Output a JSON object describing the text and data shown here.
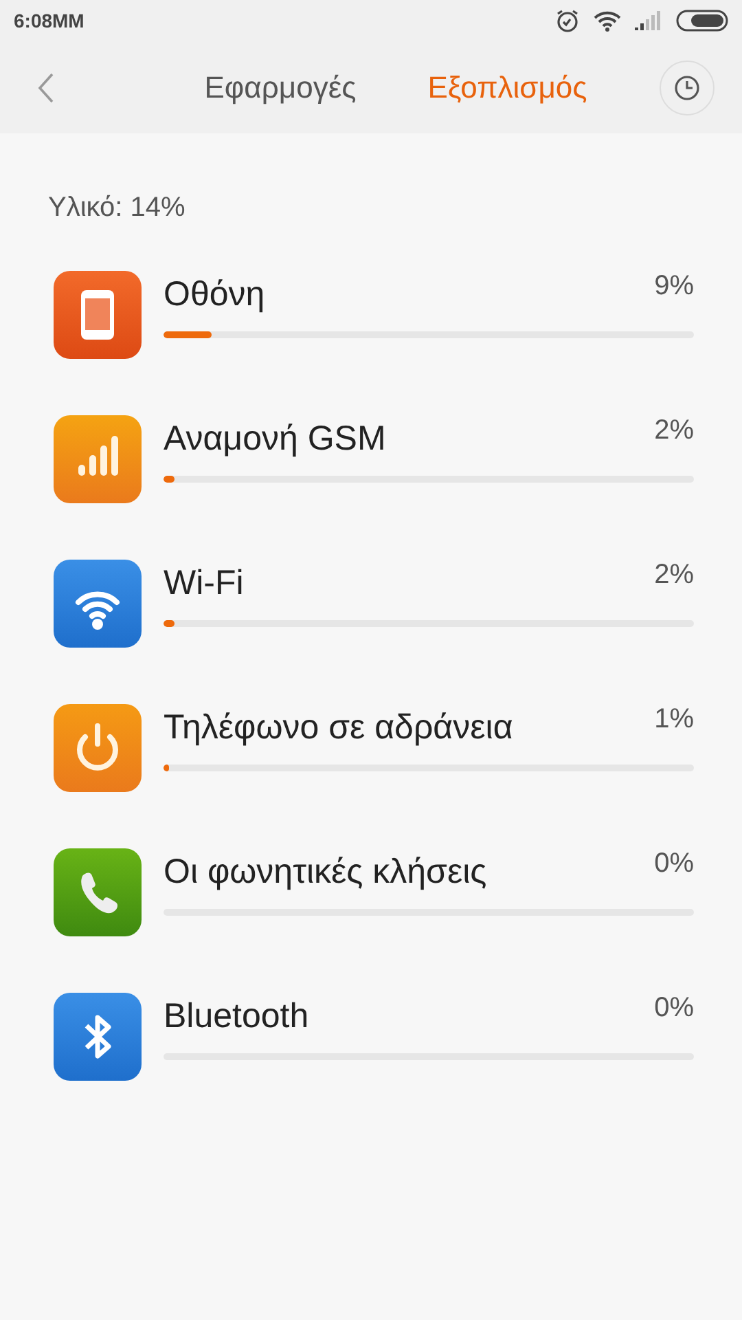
{
  "status_bar": {
    "time": "6:08MM"
  },
  "tabs": [
    {
      "label": "Εφαρμογές",
      "selected": false
    },
    {
      "label": "Εξοπλισμός",
      "selected": true
    }
  ],
  "summary": "Υλικό: 14%",
  "items": [
    {
      "kind": "screen",
      "name": "Οθόνη",
      "reading": "9%",
      "level": 0.09
    },
    {
      "kind": "signal",
      "name": "Αναμονή GSM",
      "reading": "2%",
      "level": 0.02
    },
    {
      "kind": "wifi",
      "name": "Wi-Fi",
      "reading": "2%",
      "level": 0.02
    },
    {
      "kind": "power",
      "name": "Τηλέφωνο σε αδράνεια",
      "reading": "1%",
      "level": 0.01
    },
    {
      "kind": "phone",
      "name": "Οι φωνητικές κλήσεις",
      "reading": "0%",
      "level": 0
    },
    {
      "kind": "bluetooth",
      "name": "Bluetooth",
      "reading": "0%",
      "level": 0
    }
  ]
}
